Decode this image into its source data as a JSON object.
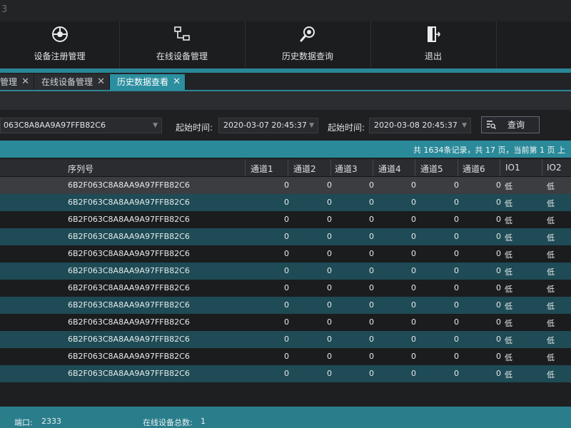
{
  "window": {
    "title_fragment": "3"
  },
  "toolbar": {
    "items": [
      {
        "label": "设备注册管理",
        "icon": "device-register-icon"
      },
      {
        "label": "在线设备管理",
        "icon": "network-devices-icon"
      },
      {
        "label": "历史数据查询",
        "icon": "magnifier-icon"
      },
      {
        "label": "退出",
        "icon": "exit-door-icon"
      }
    ]
  },
  "tabs": [
    {
      "label": "管理",
      "active": false
    },
    {
      "label": "在线设备管理",
      "active": false
    },
    {
      "label": "历史数据查看",
      "active": true
    }
  ],
  "filter": {
    "serial_value": "063C8A8AA9A97FFB82C6",
    "start_label": "起始时间:",
    "start_value": "2020-03-07 20:45:37",
    "end_label": "起始时间:",
    "end_value": "2020-03-08 20:45:37",
    "query_label": "查询"
  },
  "pager": {
    "text": "共 1634条记录，共 17 页，当前第 1 页 上"
  },
  "table": {
    "columns": [
      "序列号",
      "通道1",
      "通道2",
      "通道3",
      "通道4",
      "通道5",
      "通道6",
      "IO1",
      "IO2"
    ],
    "rows": [
      {
        "serial": "6B2F063C8A8AA9A97FFB82C6",
        "ch1": "0",
        "ch2": "0",
        "ch3": "0",
        "ch4": "0",
        "ch5": "0",
        "ch6": "0",
        "io1": "低",
        "io2": "低"
      },
      {
        "serial": "6B2F063C8A8AA9A97FFB82C6",
        "ch1": "0",
        "ch2": "0",
        "ch3": "0",
        "ch4": "0",
        "ch5": "0",
        "ch6": "0",
        "io1": "低",
        "io2": "低"
      },
      {
        "serial": "6B2F063C8A8AA9A97FFB82C6",
        "ch1": "0",
        "ch2": "0",
        "ch3": "0",
        "ch4": "0",
        "ch5": "0",
        "ch6": "0",
        "io1": "低",
        "io2": "低"
      },
      {
        "serial": "6B2F063C8A8AA9A97FFB82C6",
        "ch1": "0",
        "ch2": "0",
        "ch3": "0",
        "ch4": "0",
        "ch5": "0",
        "ch6": "0",
        "io1": "低",
        "io2": "低"
      },
      {
        "serial": "6B2F063C8A8AA9A97FFB82C6",
        "ch1": "0",
        "ch2": "0",
        "ch3": "0",
        "ch4": "0",
        "ch5": "0",
        "ch6": "0",
        "io1": "低",
        "io2": "低"
      },
      {
        "serial": "6B2F063C8A8AA9A97FFB82C6",
        "ch1": "0",
        "ch2": "0",
        "ch3": "0",
        "ch4": "0",
        "ch5": "0",
        "ch6": "0",
        "io1": "低",
        "io2": "低"
      },
      {
        "serial": "6B2F063C8A8AA9A97FFB82C6",
        "ch1": "0",
        "ch2": "0",
        "ch3": "0",
        "ch4": "0",
        "ch5": "0",
        "ch6": "0",
        "io1": "低",
        "io2": "低"
      },
      {
        "serial": "6B2F063C8A8AA9A97FFB82C6",
        "ch1": "0",
        "ch2": "0",
        "ch3": "0",
        "ch4": "0",
        "ch5": "0",
        "ch6": "0",
        "io1": "低",
        "io2": "低"
      },
      {
        "serial": "6B2F063C8A8AA9A97FFB82C6",
        "ch1": "0",
        "ch2": "0",
        "ch3": "0",
        "ch4": "0",
        "ch5": "0",
        "ch6": "0",
        "io1": "低",
        "io2": "低"
      },
      {
        "serial": "6B2F063C8A8AA9A97FFB82C6",
        "ch1": "0",
        "ch2": "0",
        "ch3": "0",
        "ch4": "0",
        "ch5": "0",
        "ch6": "0",
        "io1": "低",
        "io2": "低"
      },
      {
        "serial": "6B2F063C8A8AA9A97FFB82C6",
        "ch1": "0",
        "ch2": "0",
        "ch3": "0",
        "ch4": "0",
        "ch5": "0",
        "ch6": "0",
        "io1": "低",
        "io2": "低"
      },
      {
        "serial": "6B2F063C8A8AA9A97FFB82C6",
        "ch1": "0",
        "ch2": "0",
        "ch3": "0",
        "ch4": "0",
        "ch5": "0",
        "ch6": "0",
        "io1": "低",
        "io2": "低"
      }
    ]
  },
  "status": {
    "port_label": "端口:",
    "port_value": "2333",
    "online_label": "在线设备总数:",
    "online_value": "1"
  },
  "colors": {
    "accent": "#2a8796",
    "row_alt": "#1e4b55",
    "background": "#1d1e20"
  }
}
